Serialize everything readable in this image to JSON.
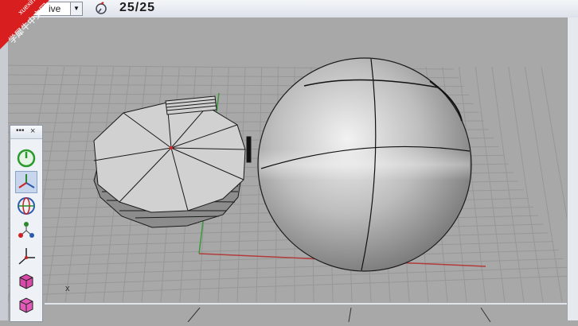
{
  "topbar": {
    "view_label": "ive",
    "counter": "25/25"
  },
  "toolbar": {
    "header_dots": "•••",
    "close": "×",
    "buttons": [
      {
        "icon": "power-icon"
      },
      {
        "icon": "gumball-axes-icon"
      },
      {
        "icon": "globe-icon"
      },
      {
        "icon": "points-icon"
      },
      {
        "icon": "transform-axes-icon"
      },
      {
        "icon": "box-edit-icon"
      },
      {
        "icon": "box-icon"
      }
    ]
  },
  "viewport": {
    "axis_label": "x"
  },
  "watermark": {
    "line1": "xuexiniu",
    "line2": "学犀牛中文网"
  },
  "colors": {
    "grid_bg": "#a8a8a8",
    "grid_line": "#979797",
    "x_axis": "#b23b3b",
    "y_axis": "#3a9a3a",
    "watermark": "#d81e1e"
  }
}
